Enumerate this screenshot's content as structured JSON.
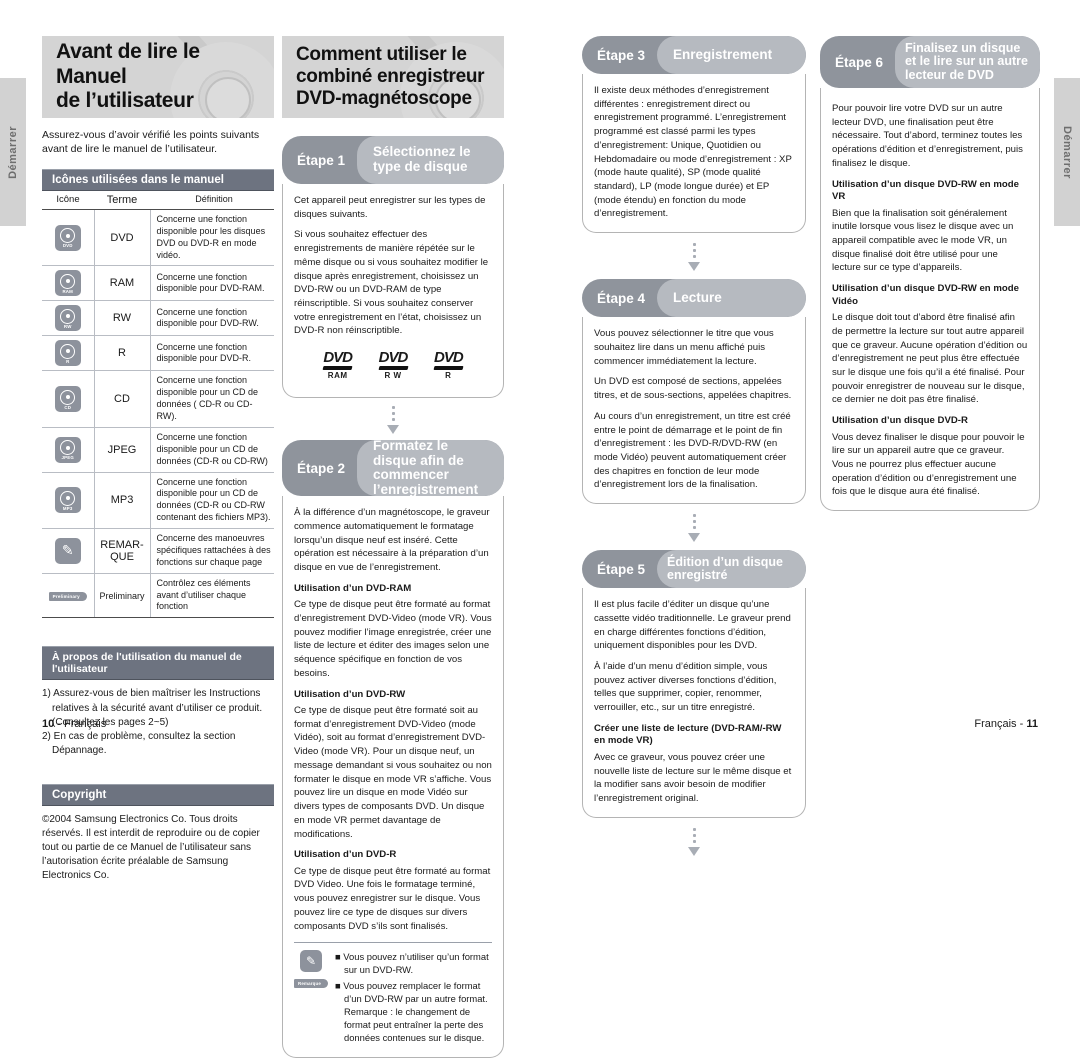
{
  "side_tabs": {
    "left_label": "Démarrer",
    "right_label": "Démarrer"
  },
  "left_page": {
    "banner_title_line1": "Avant de lire le Manuel",
    "banner_title_line2": "de l’utilisateur",
    "intro": "Assurez-vous d’avoir vérifié les points suivants avant de lire le manuel de l’utilisateur.",
    "icons_section": {
      "bar_label": "Icônes utilisées dans le manuel",
      "headers": [
        "Icône",
        "Terme",
        "Définition"
      ],
      "rows": [
        {
          "icon": "disc-dvd-icon",
          "icon_label": "DVD",
          "term": "DVD",
          "definition": "Concerne une fonction disponible pour les disques DVD ou DVD-R en mode vidéo."
        },
        {
          "icon": "disc-ram-icon",
          "icon_label": "RAM",
          "term": "RAM",
          "definition": "Concerne une fonction disponible pour DVD-RAM."
        },
        {
          "icon": "disc-rw-icon",
          "icon_label": "RW",
          "term": "RW",
          "definition": "Concerne une fonction disponible pour DVD-RW."
        },
        {
          "icon": "disc-r-icon",
          "icon_label": "R",
          "term": "R",
          "definition": "Concerne une fonction disponible pour DVD-R."
        },
        {
          "icon": "disc-cd-icon",
          "icon_label": "CD",
          "term": "CD",
          "definition": "Concerne une fonction disponible pour un CD de données ( CD-R ou CD-RW)."
        },
        {
          "icon": "disc-jpeg-icon",
          "icon_label": "JPEG",
          "term": "JPEG",
          "definition": "Concerne une fonction disponible pour un CD de données (CD-R ou CD-RW)"
        },
        {
          "icon": "disc-mp3-icon",
          "icon_label": "MP3",
          "term": "MP3",
          "definition": "Concerne une fonction disponible pour un CD de données (CD-R ou CD-RW contenant des fichiers MP3)."
        },
        {
          "icon": "pencil-remark-icon",
          "icon_label": "",
          "term": "REMAR-\nQUE",
          "definition": "Concerne des manoeuvres spécifiques rattachées à des fonctions sur chaque page"
        },
        {
          "icon": "preliminary-tag-icon",
          "icon_label": "Preliminary",
          "term": "Preliminary",
          "definition": "Contrôlez ces éléments avant d’utiliser chaque fonction"
        }
      ]
    },
    "usage_section": {
      "bar_label": "À propos de l'utilisation du manuel de l'utilisateur",
      "items": [
        "1) Assurez-vous de bien maîtriser les Instructions relatives à la sécurité avant d’utiliser ce produit. (Consultez les pages 2~5)",
        "2) En cas de problème, consultez la section Dépannage."
      ]
    },
    "copyright_section": {
      "bar_label": "Copyright",
      "text": "©2004 Samsung Electronics Co. Tous droits réservés. Il est interdit de reproduire ou de copier tout ou partie de ce Manuel de l’utilisateur sans l’autorisation écrite préalable de Samsung Electronics Co."
    },
    "footer_page": "10",
    "footer_sep": "-",
    "footer_lang": "Français"
  },
  "column_2": {
    "banner_title_line1": "Comment utiliser le",
    "banner_title_line2": "combiné enregistreur",
    "banner_title_line3": "DVD-magnétoscope",
    "step1": {
      "num": "Étape 1",
      "title": "Sélectionnez le type de disque",
      "paragraphs": [
        "Cet appareil peut enregistrer sur les types de disques suivants.",
        "Si vous souhaitez effectuer des enregistrements de manière répétée sur le même disque ou si vous souhaitez modifier le disque après enregistrement, choisissez un DVD-RW ou un DVD-RAM de type réinscriptible. Si vous souhaitez conserver votre enregistrement en l’état, choisissez un DVD-R non réinscriptible."
      ],
      "logos": [
        {
          "word": "DVD",
          "sub": "RAM"
        },
        {
          "word": "DVD",
          "sub": "R W"
        },
        {
          "word": "DVD",
          "sub": "R"
        }
      ]
    },
    "step2": {
      "num": "Étape 2",
      "title": "Formatez le disque afin de commencer l’enregistrement",
      "intro": "À la différence d’un magnétoscope, le graveur commence automatiquement le formatage lorsqu’un disque neuf est inséré. Cette opération est nécessaire à la préparation d’un disque en vue de l’enregistrement.",
      "sub1_heading": "Utilisation d’un DVD-RAM",
      "sub1_text": "Ce type de disque peut être formaté au format d’enregistrement DVD-Video (mode VR). Vous pouvez modifier l’image enregistrée, créer une liste de lecture et éditer des images selon une séquence spécifique en fonction de vos besoins.",
      "sub2_heading": "Utilisation d’un DVD-RW",
      "sub2_text": "Ce type de disque peut être formaté soit au format d’enregistrement DVD-Video (mode Vidéo), soit au format d’enregistrement DVD-Video (mode VR). Pour un disque neuf, un message demandant si vous souhaitez ou non formater le disque en mode VR s’affiche. Vous pouvez lire un disque en mode Vidéo sur divers types de composants DVD. Un disque en mode VR permet davantage de modifications.",
      "sub3_heading": "Utilisation d’un DVD-R",
      "sub3_text": "Ce type de disque peut être formaté au format DVD Video. Une fois le formatage terminé, vous pouvez enregistrer sur le disque. Vous pouvez lire ce type de disques sur divers composants DVD s’ils sont finalisés.",
      "note_icon_label": "Remarque",
      "note_items": [
        "Vous pouvez n’utiliser qu’un format sur un DVD-RW.",
        "Vous pouvez remplacer le format d’un DVD-RW par un autre format. Remarque : le changement de format peut entraîner la perte des données contenues sur le disque."
      ]
    }
  },
  "column_3": {
    "step3": {
      "num": "Étape 3",
      "title": "Enregistrement",
      "text": "Il existe deux méthodes d’enregistrement différentes : enregistrement direct ou enregistrement programmé. L’enregistrement programmé est classé parmi les types d’enregistrement: Unique, Quotidien ou Hebdomadaire ou mode d’enregistrement : XP (mode haute qualité), SP (mode qualité standard), LP (mode longue durée) et EP (mode étendu) en fonction du mode d’enregistrement."
    },
    "step4": {
      "num": "Étape 4",
      "title": "Lecture",
      "paragraphs": [
        "Vous pouvez sélectionner le titre que vous souhaitez lire dans un menu affiché puis commencer immédiatement la lecture.",
        "Un DVD est composé de sections, appelées titres, et de sous-sections, appelées chapitres.",
        "Au cours d’un enregistrement, un titre est créé entre le point de démarrage et le point de fin d’enregistrement : les DVD-R/DVD-RW (en mode Vidéo) peuvent automatiquement créer des chapitres en fonction de leur mode d’enregistrement lors de la finalisation."
      ]
    },
    "step5": {
      "num": "Étape 5",
      "title": "Édition d’un disque enregistré",
      "paragraphs": [
        "Il est plus facile d’éditer un disque qu’une cassette vidéo traditionnelle. Le graveur prend en charge différentes fonctions d’édition, uniquement disponibles pour les DVD.",
        "À l’aide d’un menu d’édition simple, vous pouvez activer diverses fonctions d’édition, telles que supprimer, copier, renommer, verrouiller, etc., sur un titre enregistré."
      ],
      "sub_heading": "Créer une liste de lecture (DVD-RAM/-RW en mode VR)",
      "sub_text": "Avec ce graveur, vous pouvez créer une nouvelle liste de lecture sur le même disque et la modifier sans avoir besoin de modifier l’enregistrement original."
    }
  },
  "column_4": {
    "step6": {
      "num": "Étape 6",
      "title": "Finalisez un disque et le lire sur un autre lecteur de DVD",
      "intro": "Pour pouvoir lire votre DVD sur un autre lecteur DVD, une finalisation peut être nécessaire. Tout d’abord, terminez toutes les opérations d’édition et d’enregistrement, puis finalisez le disque.",
      "sub1_heading": "Utilisation d’un disque DVD-RW en mode VR",
      "sub1_text": "Bien que la finalisation soit généralement inutile lorsque vous lisez le disque avec un appareil compatible avec le mode VR, un disque finalisé doit être utilisé pour une lecture sur ce type d’appareils.",
      "sub2_heading": "Utilisation d’un disque DVD-RW en mode Vidéo",
      "sub2_text": "Le disque doit tout d’abord être finalisé afin de permettre la lecture sur tout autre appareil que ce graveur. Aucune opération d’édition ou d’enregistrement ne peut plus être effectuée sur le disque une fois qu’il a été finalisé. Pour pouvoir enregistrer de nouveau sur le disque, ce dernier ne doit pas être finalisé.",
      "sub3_heading": "Utilisation d’un disque DVD-R",
      "sub3_text": "Vous devez finaliser le disque pour pouvoir le lire sur un appareil autre que ce graveur. Vous ne pourrez plus effectuer aucune operation d’édition ou d’enregistrement une fois que le disque aura été finalisé."
    },
    "footer_lang": "Français",
    "footer_sep": "-",
    "footer_page": "11"
  }
}
